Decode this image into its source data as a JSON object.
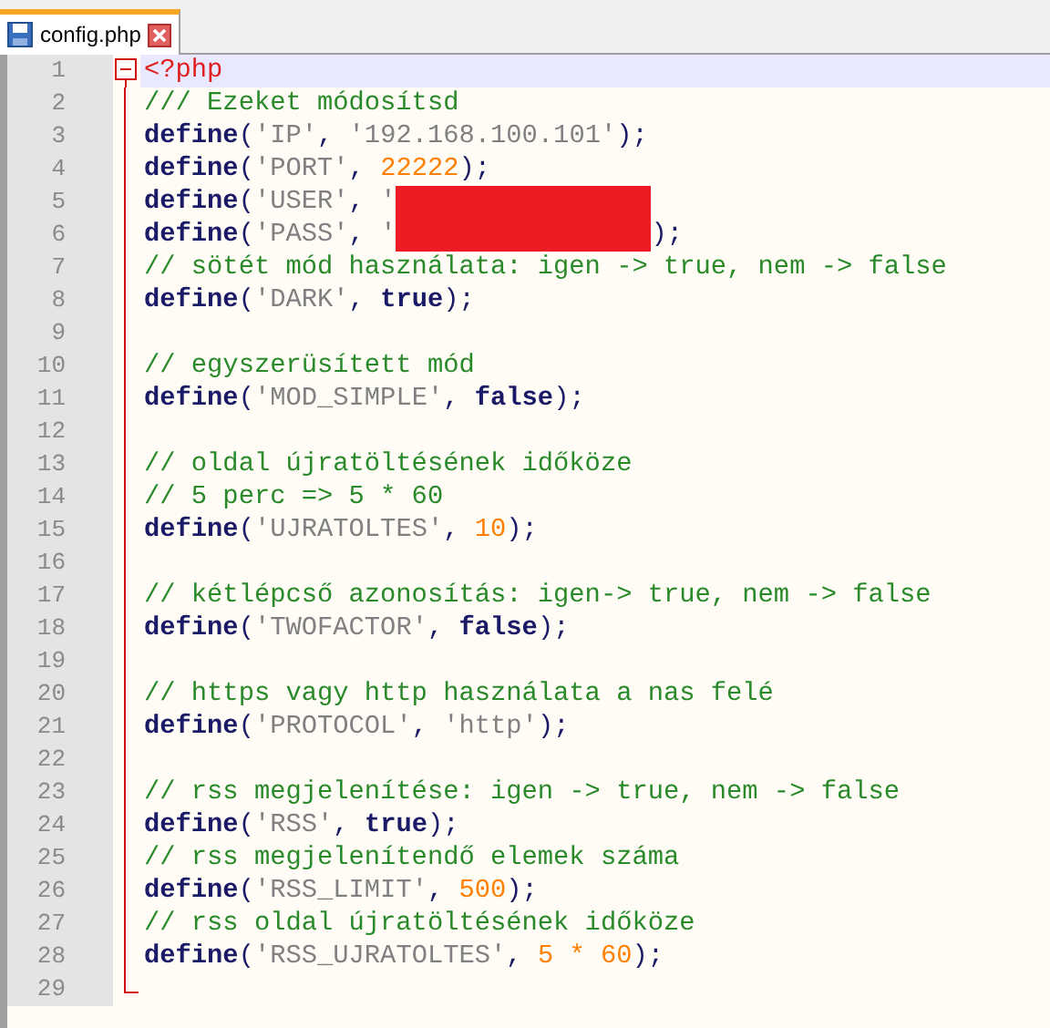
{
  "tabs": [
    {
      "label": "config.php",
      "selected": true
    }
  ],
  "lines": [
    {
      "number": "1",
      "current": true,
      "tokens": [
        {
          "kind": "tag",
          "text": "<?php"
        }
      ]
    },
    {
      "number": "2",
      "current": false,
      "tokens": [
        {
          "kind": "comment",
          "text": "/// Ezeket módosítsd"
        }
      ]
    },
    {
      "number": "3",
      "current": false,
      "tokens": [
        {
          "kind": "keyword",
          "text": "define"
        },
        {
          "kind": "punct",
          "text": "("
        },
        {
          "kind": "string",
          "text": "'IP'"
        },
        {
          "kind": "punct",
          "text": ", "
        },
        {
          "kind": "string",
          "text": "'192.168.100.101'"
        },
        {
          "kind": "punct",
          "text": ");"
        }
      ]
    },
    {
      "number": "4",
      "current": false,
      "tokens": [
        {
          "kind": "keyword",
          "text": "define"
        },
        {
          "kind": "punct",
          "text": "("
        },
        {
          "kind": "string",
          "text": "'PORT'"
        },
        {
          "kind": "punct",
          "text": ", "
        },
        {
          "kind": "number",
          "text": "22222"
        },
        {
          "kind": "punct",
          "text": ");"
        }
      ]
    },
    {
      "number": "5",
      "current": false,
      "tokens": [
        {
          "kind": "keyword",
          "text": "define"
        },
        {
          "kind": "punct",
          "text": "("
        },
        {
          "kind": "string",
          "text": "'USER'"
        },
        {
          "kind": "punct",
          "text": ", "
        },
        {
          "kind": "string",
          "text": "'"
        },
        {
          "kind": "redacted"
        }
      ]
    },
    {
      "number": "6",
      "current": false,
      "tokens": [
        {
          "kind": "keyword",
          "text": "define"
        },
        {
          "kind": "punct",
          "text": "("
        },
        {
          "kind": "string",
          "text": "'PASS'"
        },
        {
          "kind": "punct",
          "text": ", "
        },
        {
          "kind": "string",
          "text": "'"
        },
        {
          "kind": "redacted"
        },
        {
          "kind": "punct",
          "text": ");"
        }
      ]
    },
    {
      "number": "7",
      "current": false,
      "tokens": [
        {
          "kind": "comment",
          "text": "// sötét mód használata: igen -> true, nem -> false"
        }
      ]
    },
    {
      "number": "8",
      "current": false,
      "tokens": [
        {
          "kind": "keyword",
          "text": "define"
        },
        {
          "kind": "punct",
          "text": "("
        },
        {
          "kind": "string",
          "text": "'DARK'"
        },
        {
          "kind": "punct",
          "text": ", "
        },
        {
          "kind": "bool",
          "text": "true"
        },
        {
          "kind": "punct",
          "text": ");"
        }
      ]
    },
    {
      "number": "9",
      "current": false
    },
    {
      "number": "10",
      "current": false,
      "tokens": [
        {
          "kind": "comment",
          "text": "// egyszerüsített mód"
        }
      ]
    },
    {
      "number": "11",
      "current": false,
      "tokens": [
        {
          "kind": "keyword",
          "text": "define"
        },
        {
          "kind": "punct",
          "text": "("
        },
        {
          "kind": "string",
          "text": "'MOD_SIMPLE'"
        },
        {
          "kind": "punct",
          "text": ", "
        },
        {
          "kind": "bool",
          "text": "false"
        },
        {
          "kind": "punct",
          "text": ");"
        }
      ]
    },
    {
      "number": "12",
      "current": false
    },
    {
      "number": "13",
      "current": false,
      "tokens": [
        {
          "kind": "comment",
          "text": "// oldal újratöltésének időköze"
        }
      ]
    },
    {
      "number": "14",
      "current": false,
      "tokens": [
        {
          "kind": "comment",
          "text": "// 5 perc => 5 * 60"
        }
      ]
    },
    {
      "number": "15",
      "current": false,
      "tokens": [
        {
          "kind": "keyword",
          "text": "define"
        },
        {
          "kind": "punct",
          "text": "("
        },
        {
          "kind": "string",
          "text": "'UJRATOLTES'"
        },
        {
          "kind": "punct",
          "text": ", "
        },
        {
          "kind": "number",
          "text": "10"
        },
        {
          "kind": "punct",
          "text": ");"
        }
      ]
    },
    {
      "number": "16",
      "current": false
    },
    {
      "number": "17",
      "current": false,
      "tokens": [
        {
          "kind": "comment",
          "text": "// kétlépcső azonosítás: igen-> true, nem -> false"
        }
      ]
    },
    {
      "number": "18",
      "current": false,
      "tokens": [
        {
          "kind": "keyword",
          "text": "define"
        },
        {
          "kind": "punct",
          "text": "("
        },
        {
          "kind": "string",
          "text": "'TWOFACTOR'"
        },
        {
          "kind": "punct",
          "text": ", "
        },
        {
          "kind": "bool",
          "text": "false"
        },
        {
          "kind": "punct",
          "text": ");"
        }
      ]
    },
    {
      "number": "19",
      "current": false
    },
    {
      "number": "20",
      "current": false,
      "tokens": [
        {
          "kind": "comment",
          "text": "// https vagy http használata a nas felé"
        }
      ]
    },
    {
      "number": "21",
      "current": false,
      "tokens": [
        {
          "kind": "keyword",
          "text": "define"
        },
        {
          "kind": "punct",
          "text": "("
        },
        {
          "kind": "string",
          "text": "'PROTOCOL'"
        },
        {
          "kind": "punct",
          "text": ", "
        },
        {
          "kind": "string",
          "text": "'http'"
        },
        {
          "kind": "punct",
          "text": ");"
        }
      ]
    },
    {
      "number": "22",
      "current": false
    },
    {
      "number": "23",
      "current": false,
      "tokens": [
        {
          "kind": "comment",
          "text": "// rss megjelenítése: igen -> true, nem -> false"
        }
      ]
    },
    {
      "number": "24",
      "current": false,
      "tokens": [
        {
          "kind": "keyword",
          "text": "define"
        },
        {
          "kind": "punct",
          "text": "("
        },
        {
          "kind": "string",
          "text": "'RSS'"
        },
        {
          "kind": "punct",
          "text": ", "
        },
        {
          "kind": "bool",
          "text": "true"
        },
        {
          "kind": "punct",
          "text": ");"
        }
      ]
    },
    {
      "number": "25",
      "current": false,
      "tokens": [
        {
          "kind": "comment",
          "text": "// rss megjelenítendő elemek száma"
        }
      ]
    },
    {
      "number": "26",
      "current": false,
      "tokens": [
        {
          "kind": "keyword",
          "text": "define"
        },
        {
          "kind": "punct",
          "text": "("
        },
        {
          "kind": "string",
          "text": "'RSS_LIMIT'"
        },
        {
          "kind": "punct",
          "text": ", "
        },
        {
          "kind": "number",
          "text": "500"
        },
        {
          "kind": "punct",
          "text": ");"
        }
      ]
    },
    {
      "number": "27",
      "current": false,
      "tokens": [
        {
          "kind": "comment",
          "text": "// rss oldal újratöltésének időköze"
        }
      ]
    },
    {
      "number": "28",
      "current": false,
      "tokens": [
        {
          "kind": "keyword",
          "text": "define"
        },
        {
          "kind": "punct",
          "text": "("
        },
        {
          "kind": "string",
          "text": "'RSS_UJRATOLTES'"
        },
        {
          "kind": "punct",
          "text": ", "
        },
        {
          "kind": "number",
          "text": "5 * 60"
        },
        {
          "kind": "punct",
          "text": ");"
        }
      ]
    },
    {
      "number": "29",
      "current": false
    }
  ]
}
